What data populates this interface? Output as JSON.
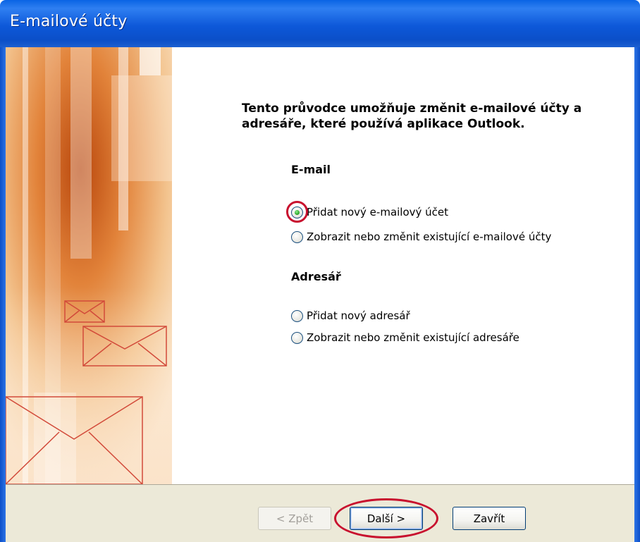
{
  "window": {
    "title": "E-mailové účty"
  },
  "intro": "Tento průvodce umožňuje změnit e-mailové účty a adresáře, které používá aplikace Outlook.",
  "email_section": {
    "heading": "E-mail",
    "options": [
      {
        "label": "Přidat nový e-mailový účet",
        "checked": true
      },
      {
        "label": "Zobrazit nebo změnit existující e-mailové účty",
        "checked": false
      }
    ]
  },
  "address_book_section": {
    "heading": "Adresář",
    "options": [
      {
        "label": "Přidat nový adresář",
        "checked": false
      },
      {
        "label": "Zobrazit nebo změnit existující adresáře",
        "checked": false
      }
    ]
  },
  "buttons": {
    "back": "< Zpět",
    "next": "Další >",
    "close": "Zavřít"
  },
  "colors": {
    "title_bar": "#0b4fc8",
    "annotation": "#c8102e",
    "footer": "#ece9d8"
  }
}
